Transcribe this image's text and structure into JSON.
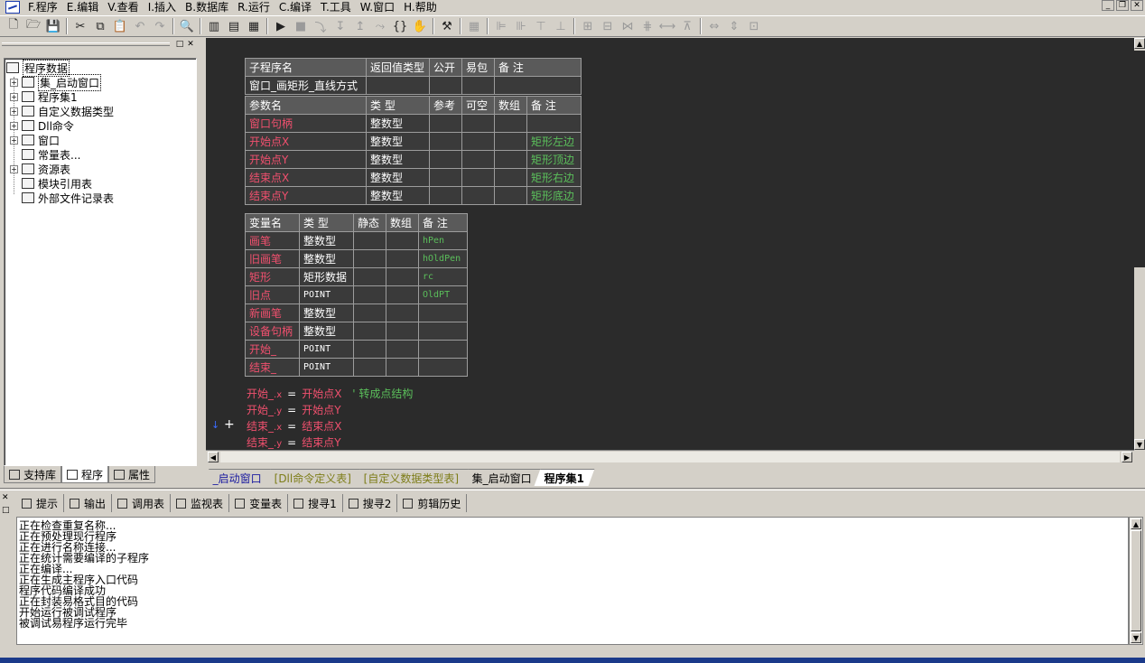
{
  "menu": [
    "F.程序",
    "E.编辑",
    "V.查看",
    "I.插入",
    "B.数据库",
    "R.运行",
    "C.编译",
    "T.工具",
    "W.窗口",
    "H.帮助"
  ],
  "toolbar_icons": [
    "new-icon",
    "open-icon",
    "save-icon",
    "cut-icon",
    "copy-icon",
    "paste-icon",
    "undo-icon",
    "redo-icon",
    "find-icon",
    "layout1-icon",
    "layout2-icon",
    "layout3-icon",
    "run-icon",
    "stop-icon",
    "step-icon",
    "step-into-icon",
    "step-out-icon",
    "run-to-icon",
    "hand-icon",
    "compile-icon"
  ],
  "tree": {
    "root": "程序数据",
    "items": [
      {
        "label": "集_启动窗口"
      },
      {
        "label": "程序集1"
      },
      {
        "label": "自定义数据类型"
      },
      {
        "label": "Dll命令"
      },
      {
        "label": "窗口"
      },
      {
        "label": "常量表..."
      },
      {
        "label": "资源表"
      },
      {
        "label": "模块引用表"
      },
      {
        "label": "外部文件记录表"
      }
    ]
  },
  "left_tabs": [
    "支持库",
    "程序",
    "属性"
  ],
  "sub_table": {
    "headers": [
      "子程序名",
      "返回值类型",
      "公开",
      "易包",
      "备 注"
    ],
    "name": "窗口_画矩形_直线方式"
  },
  "param_table": {
    "headers": [
      "参数名",
      "类 型",
      "参考",
      "可空",
      "数组",
      "备 注"
    ],
    "rows": [
      {
        "name": "窗口句柄",
        "type": "整数型",
        "note": ""
      },
      {
        "name": "开始点X",
        "type": "整数型",
        "note": "矩形左边"
      },
      {
        "name": "开始点Y",
        "type": "整数型",
        "note": "矩形顶边"
      },
      {
        "name": "结束点X",
        "type": "整数型",
        "note": "矩形右边"
      },
      {
        "name": "结束点Y",
        "type": "整数型",
        "note": "矩形底边"
      }
    ]
  },
  "var_table": {
    "headers": [
      "变量名",
      "类 型",
      "静态",
      "数组",
      "备 注"
    ],
    "rows": [
      {
        "name": "画笔",
        "type": "整数型",
        "note": "hPen"
      },
      {
        "name": "旧画笔",
        "type": "整数型",
        "note": "hOldPen"
      },
      {
        "name": "矩形",
        "type": "矩形数据",
        "note": "rc"
      },
      {
        "name": "旧点",
        "type": "POINT",
        "note": "OldPT"
      },
      {
        "name": "新画笔",
        "type": "整数型",
        "note": ""
      },
      {
        "name": "设备句柄",
        "type": "整数型",
        "note": ""
      },
      {
        "name": "开始_",
        "type": "POINT",
        "note": ""
      },
      {
        "name": "结束_",
        "type": "POINT",
        "note": ""
      }
    ]
  },
  "code_lines": [
    {
      "var": "开始_",
      "member": ".x",
      "rhs": "开始点X",
      "comment": "' 转成点结构"
    },
    {
      "var": "开始_",
      "member": ".y",
      "rhs": "开始点Y",
      "comment": ""
    },
    {
      "var": "结束_",
      "member": ".x",
      "rhs": "结束点X",
      "comment": ""
    },
    {
      "var": "结束_",
      "member": ".y",
      "rhs": "结束点Y",
      "comment": ""
    }
  ],
  "assign_op": "=",
  "doc_tabs": [
    "_启动窗口",
    "[Dll命令定义表]",
    "[自定义数据类型表]",
    "集_启动窗口",
    "程序集1"
  ],
  "bottom_tabs": [
    "提示",
    "输出",
    "调用表",
    "监视表",
    "变量表",
    "搜寻1",
    "搜寻2",
    "剪辑历史"
  ],
  "output_lines": [
    "正在检查重复名称...",
    "正在预处理现行程序",
    "正在进行名称连接...",
    "正在统计需要编译的子程序",
    "正在编译...",
    "正在生成主程序入口代码",
    "程序代码编译成功",
    "正在封装易格式目的代码",
    "开始运行被调试程序",
    "被调试易程序运行完毕"
  ],
  "colors": {
    "editor_bg": "#2b2b2b",
    "identifier": "#f0506e",
    "comment": "#5bbf5b",
    "header_bg": "#5a5a5a"
  }
}
